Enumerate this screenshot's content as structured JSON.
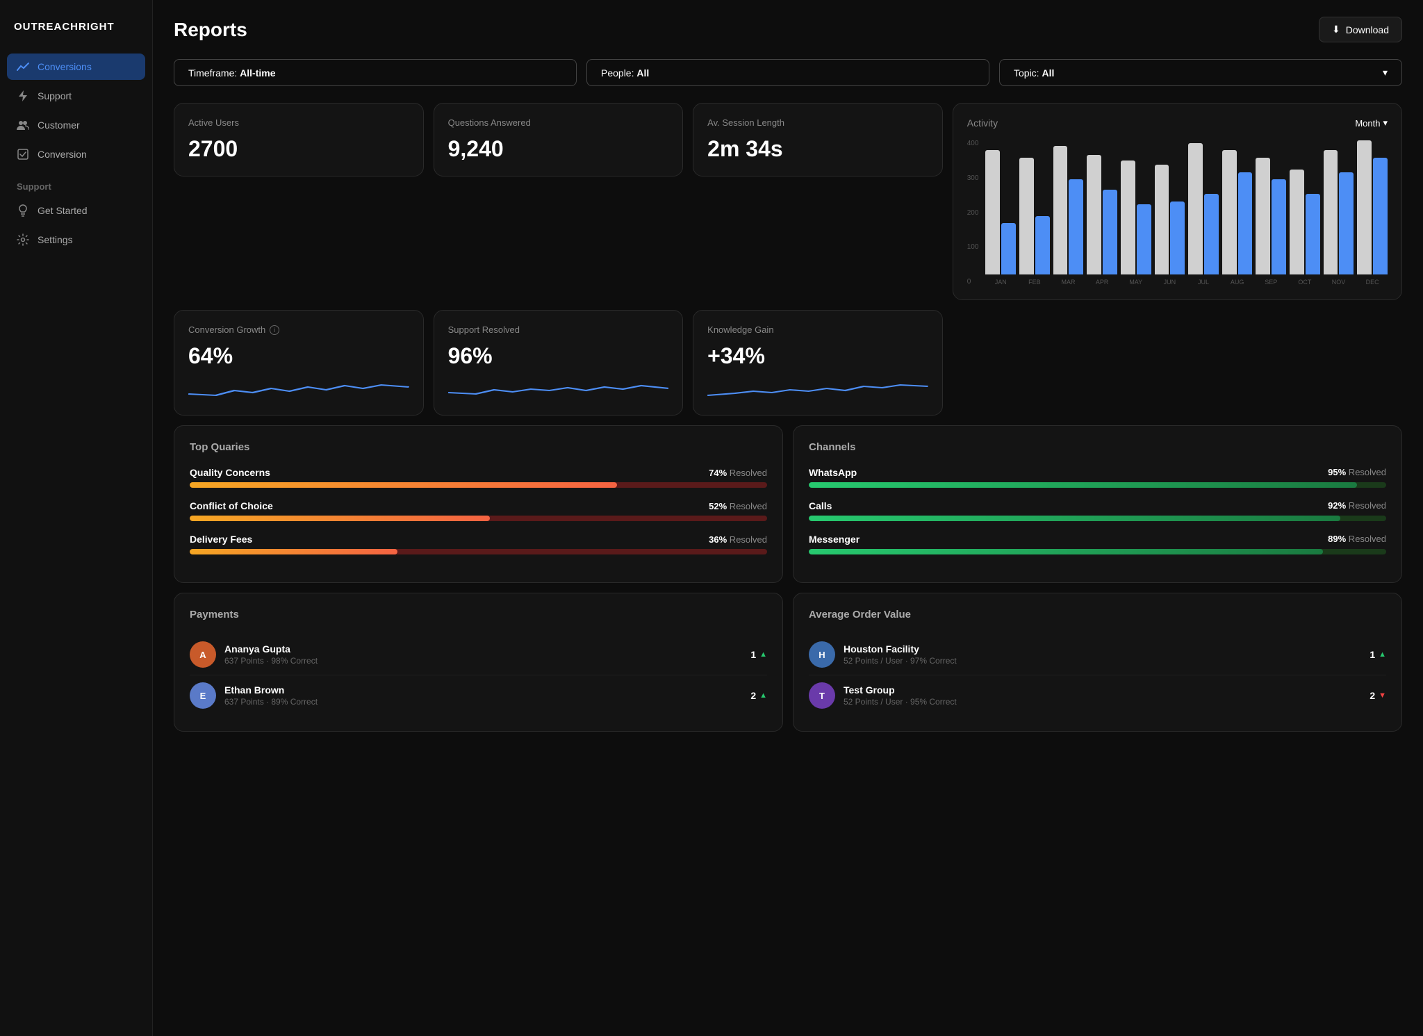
{
  "brand": "OUTREACHRIGHT",
  "sidebar": {
    "nav_items": [
      {
        "id": "conversions",
        "label": "Conversions",
        "active": true,
        "icon": "chart-icon"
      },
      {
        "id": "support",
        "label": "Support",
        "active": false,
        "icon": "bolt-icon"
      },
      {
        "id": "customer",
        "label": "Customer",
        "active": false,
        "icon": "people-icon"
      },
      {
        "id": "conversion",
        "label": "Conversion",
        "active": false,
        "icon": "checklist-icon"
      }
    ],
    "support_section": "Support",
    "support_items": [
      {
        "id": "get-started",
        "label": "Get Started",
        "icon": "bulb-icon"
      },
      {
        "id": "settings",
        "label": "Settings",
        "icon": "gear-icon"
      }
    ]
  },
  "header": {
    "title": "Reports",
    "download_label": "Download"
  },
  "filters": {
    "timeframe_label": "Timeframe:",
    "timeframe_value": "All-time",
    "people_label": "People:",
    "people_value": "All",
    "topic_label": "Topic:",
    "topic_value": "All"
  },
  "stats": {
    "active_users": {
      "label": "Active Users",
      "value": "2700"
    },
    "questions_answered": {
      "label": "Questions Answered",
      "value": "9,240"
    },
    "av_session_length": {
      "label": "Av. Session Length",
      "value": "2m 34s"
    },
    "conversion_growth": {
      "label": "Conversion Growth",
      "value": "64%"
    },
    "support_resolved": {
      "label": "Support Resolved",
      "value": "96%"
    },
    "knowledge_gain": {
      "label": "Knowledge Gain",
      "value": "+34%"
    }
  },
  "activity": {
    "title": "Activity",
    "selector_label": "Month",
    "y_labels": [
      "400",
      "300",
      "200",
      "100",
      "0"
    ],
    "months": [
      "JAN",
      "FEB",
      "MAR",
      "APR",
      "MAY",
      "JUN",
      "JUL",
      "AUG",
      "SEP",
      "OCT",
      "NOV",
      "DEC"
    ],
    "bars": [
      {
        "white": 85,
        "blue": 35
      },
      {
        "white": 80,
        "blue": 40
      },
      {
        "white": 88,
        "blue": 65
      },
      {
        "white": 82,
        "blue": 58
      },
      {
        "white": 78,
        "blue": 48
      },
      {
        "white": 75,
        "blue": 50
      },
      {
        "white": 90,
        "blue": 55
      },
      {
        "white": 85,
        "blue": 70
      },
      {
        "white": 80,
        "blue": 65
      },
      {
        "white": 72,
        "blue": 55
      },
      {
        "white": 85,
        "blue": 70
      },
      {
        "white": 92,
        "blue": 80
      }
    ]
  },
  "top_queries": {
    "title": "Top Quaries",
    "items": [
      {
        "name": "Quality Concerns",
        "percent": 74,
        "fill_pct": 74
      },
      {
        "name": "Conflict of Choice",
        "percent": 52,
        "fill_pct": 52
      },
      {
        "name": "Delivery Fees",
        "percent": 36,
        "fill_pct": 36
      }
    ]
  },
  "channels": {
    "title": "Channels",
    "items": [
      {
        "name": "WhatsApp",
        "percent": 95,
        "fill_pct": 95
      },
      {
        "name": "Calls",
        "percent": 92,
        "fill_pct": 92
      },
      {
        "name": "Messenger",
        "percent": 89,
        "fill_pct": 89
      }
    ]
  },
  "payments": {
    "title": "Payments",
    "items": [
      {
        "name": "Ananya Gupta",
        "sub": "637 Points · 98% Correct",
        "rank": "1",
        "trend": "up",
        "avatar_color": "#c85a2a"
      },
      {
        "name": "Ethan Brown",
        "sub": "637 Points · 89% Correct",
        "rank": "2",
        "trend": "up",
        "avatar_color": "#5a7ac8"
      }
    ]
  },
  "average_order_value": {
    "title": "Average Order Value",
    "items": [
      {
        "name": "Houston Facility",
        "sub": "52 Points / User · 97% Correct",
        "rank": "1",
        "trend": "up",
        "avatar_color": "#3a6aaa"
      },
      {
        "name": "Test Group",
        "sub": "52 Points / User · 95% Correct",
        "rank": "2",
        "trend": "down",
        "avatar_color": "#6a3aaa"
      }
    ]
  }
}
